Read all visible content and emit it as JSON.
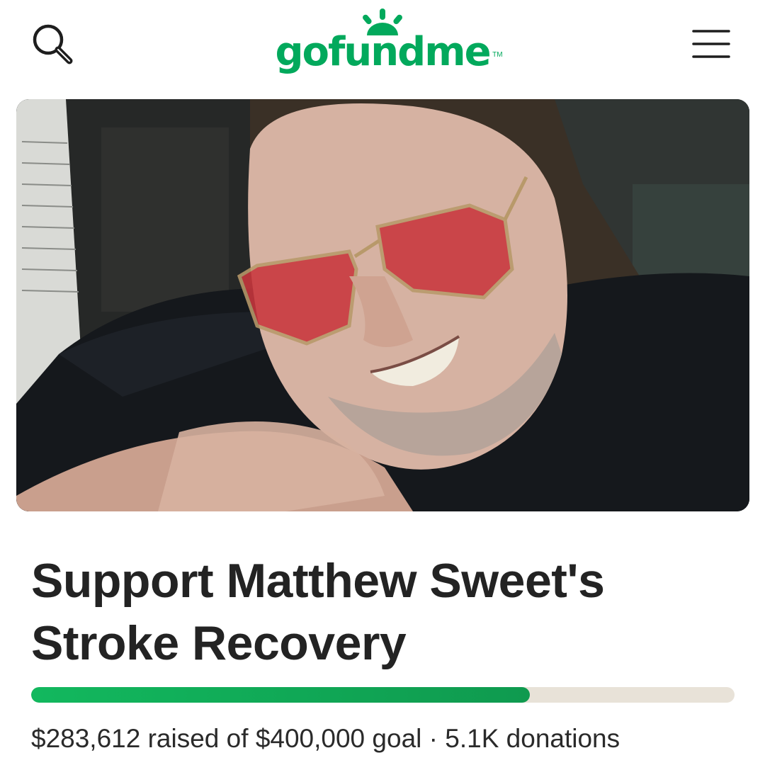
{
  "header": {
    "brand": "gofundme",
    "trademark": "TM",
    "search_icon": "search-icon",
    "menu_icon": "hamburger-menu-icon"
  },
  "campaign": {
    "title": "Support Matthew Sweet's Stroke Recovery",
    "raised": "$283,612",
    "raised_label": "raised of",
    "goal": "$400,000",
    "goal_label": "goal",
    "separator": "·",
    "donations": "5.1K donations",
    "progress_fraction": 0.709
  },
  "colors": {
    "brand_green": "#02a95c",
    "progress_fill": "#12b85e",
    "progress_track": "#e8e2d8",
    "text": "#232323"
  }
}
